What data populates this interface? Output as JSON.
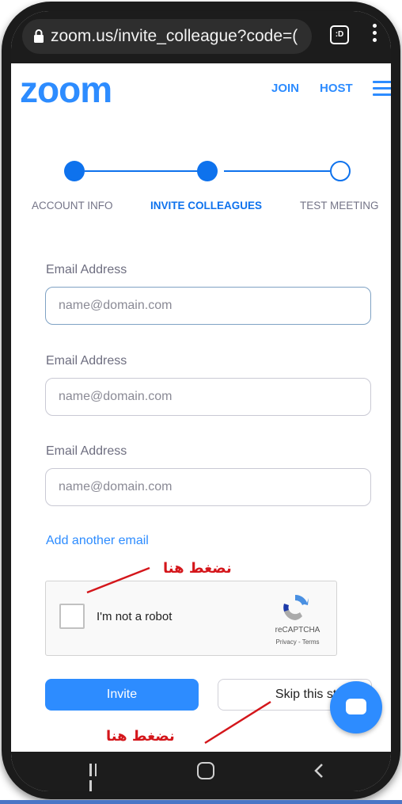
{
  "browser": {
    "url": "zoom.us/invite_colleague?code=(",
    "tab_icon_label": ":D"
  },
  "header": {
    "logo": "zoom",
    "join": "JOIN",
    "host": "HOST"
  },
  "stepper": {
    "steps": [
      {
        "label": "ACCOUNT INFO",
        "state": "done"
      },
      {
        "label": "INVITE COLLEAGUES",
        "state": "active"
      },
      {
        "label": "TEST MEETING",
        "state": "todo"
      }
    ]
  },
  "form": {
    "fields": [
      {
        "label": "Email Address",
        "placeholder": "name@domain.com",
        "value": ""
      },
      {
        "label": "Email Address",
        "placeholder": "name@domain.com",
        "value": ""
      },
      {
        "label": "Email Address",
        "placeholder": "name@domain.com",
        "value": ""
      }
    ],
    "add_another": "Add another email"
  },
  "recaptcha": {
    "label": "I'm not a robot",
    "brand": "reCAPTCHA",
    "links": "Privacy - Terms",
    "checked": false
  },
  "buttons": {
    "invite": "Invite",
    "skip": "Skip this step"
  },
  "annotations": {
    "top": "نضغط هنا",
    "bottom": "نضغط هنا"
  },
  "colors": {
    "brand_blue": "#2d8cff",
    "step_blue": "#0e72ed",
    "annotation_red": "#d4161b"
  }
}
